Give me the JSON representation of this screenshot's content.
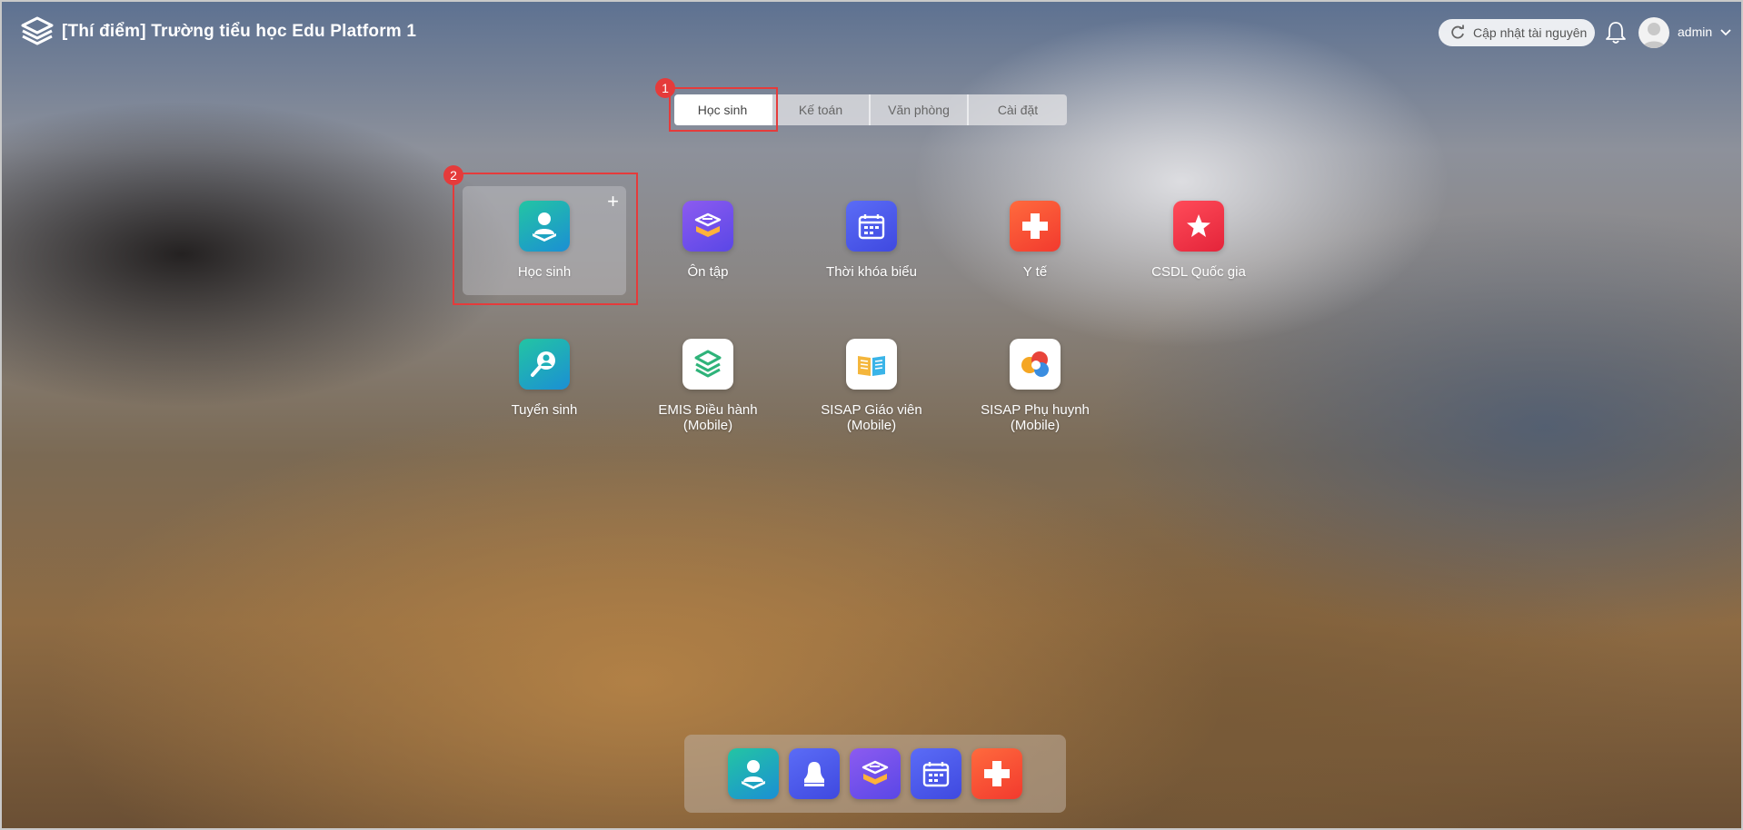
{
  "header": {
    "title": "[Thí điểm] Trường tiểu học Edu Platform 1",
    "update_label": "Cập nhật tài nguyên",
    "username": "admin"
  },
  "tabs": [
    {
      "label": "Học sinh",
      "active": true
    },
    {
      "label": "Kế toán",
      "active": false
    },
    {
      "label": "Văn phòng",
      "active": false
    },
    {
      "label": "Cài đặt",
      "active": false
    }
  ],
  "annotations": {
    "tab_marker": "1",
    "app_marker": "2"
  },
  "apps": [
    {
      "label": "Học sinh",
      "icon": "student-icon",
      "color": "#1fb0b8"
    },
    {
      "label": "Ôn tập",
      "icon": "review-book-icon",
      "color": "#7a52ee"
    },
    {
      "label": "Thời khóa biểu",
      "icon": "calendar-icon",
      "color": "#4e5cf0"
    },
    {
      "label": "Y tế",
      "icon": "medical-cross-icon",
      "color": "#f85035"
    },
    {
      "label": "CSDL Quốc gia",
      "icon": "star-icon",
      "color": "#ee3448"
    },
    {
      "label": "Tuyển sinh",
      "icon": "enrollment-search-icon",
      "color": "#1fb0b8"
    },
    {
      "label": "EMIS Điều hành\n(Mobile)",
      "icon": "emis-logo-icon",
      "color": "#ffffff"
    },
    {
      "label": "SISAP Giáo viên\n(Mobile)",
      "icon": "open-book-icon",
      "color": "#ffffff"
    },
    {
      "label": "SISAP Phụ huynh\n(Mobile)",
      "icon": "parent-app-icon",
      "color": "#ffffff"
    }
  ],
  "dock": [
    {
      "icon": "student-icon"
    },
    {
      "icon": "user-silhouette-icon"
    },
    {
      "icon": "review-book-icon"
    },
    {
      "icon": "calendar-icon"
    },
    {
      "icon": "medical-cross-icon"
    }
  ]
}
